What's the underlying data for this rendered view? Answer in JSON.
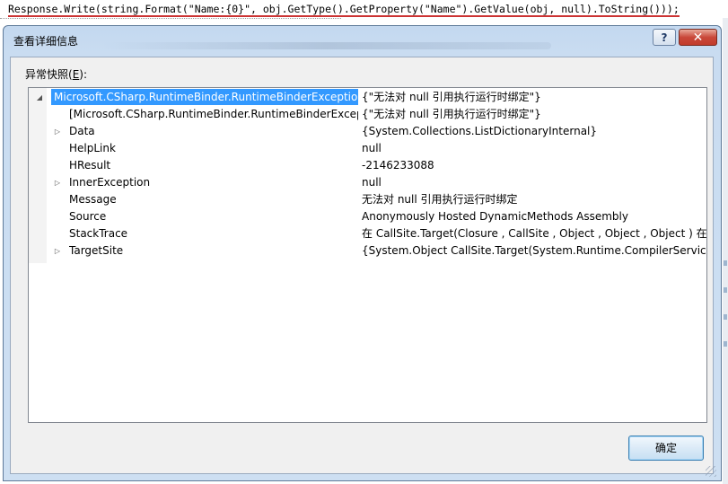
{
  "editor": {
    "code_line": "Response.Write(string.Format(\"Name:{0}\", obj.GetType().GetProperty(\"Name\").GetValue(obj, null).ToString()));"
  },
  "dialog": {
    "title": "查看详细信息",
    "help_label": "?",
    "close_label": "✕",
    "section_label_prefix": "异常快照(",
    "section_label_key": "E",
    "section_label_suffix": "):",
    "ok_label": "确定"
  },
  "tree": {
    "rows": [
      {
        "name": "Microsoft.CSharp.RuntimeBinder.RuntimeBinderException",
        "value": "{\"无法对 null 引用执行运行时绑定\"}",
        "expander": "expanded"
      },
      {
        "name": "[Microsoft.CSharp.RuntimeBinder.RuntimeBinderException]",
        "value": "{\"无法对 null 引用执行运行时绑定\"}",
        "expander": "none"
      },
      {
        "name": "Data",
        "value": "{System.Collections.ListDictionaryInternal}",
        "expander": "collapsed"
      },
      {
        "name": "HelpLink",
        "value": "null",
        "expander": "none"
      },
      {
        "name": "HResult",
        "value": "-2146233088",
        "expander": "none"
      },
      {
        "name": "InnerException",
        "value": "null",
        "expander": "collapsed"
      },
      {
        "name": "Message",
        "value": "无法对 null 引用执行运行时绑定",
        "expander": "none"
      },
      {
        "name": "Source",
        "value": "Anonymously Hosted DynamicMethods Assembly",
        "expander": "none"
      },
      {
        "name": "StackTrace",
        "value": "   在 CallSite.Target(Closure , CallSite , Object , Object , Object )   在",
        "expander": "none"
      },
      {
        "name": "TargetSite",
        "value": "{System.Object CallSite.Target(System.Runtime.CompilerServices.Closure, System.Runtime.CompilerServices.CallSite, System.Object, System.Object, System.Object)}",
        "expander": "collapsed"
      }
    ]
  },
  "icons": {
    "expanded": "triangle-down-icon",
    "collapsed": "triangle-right-icon"
  }
}
